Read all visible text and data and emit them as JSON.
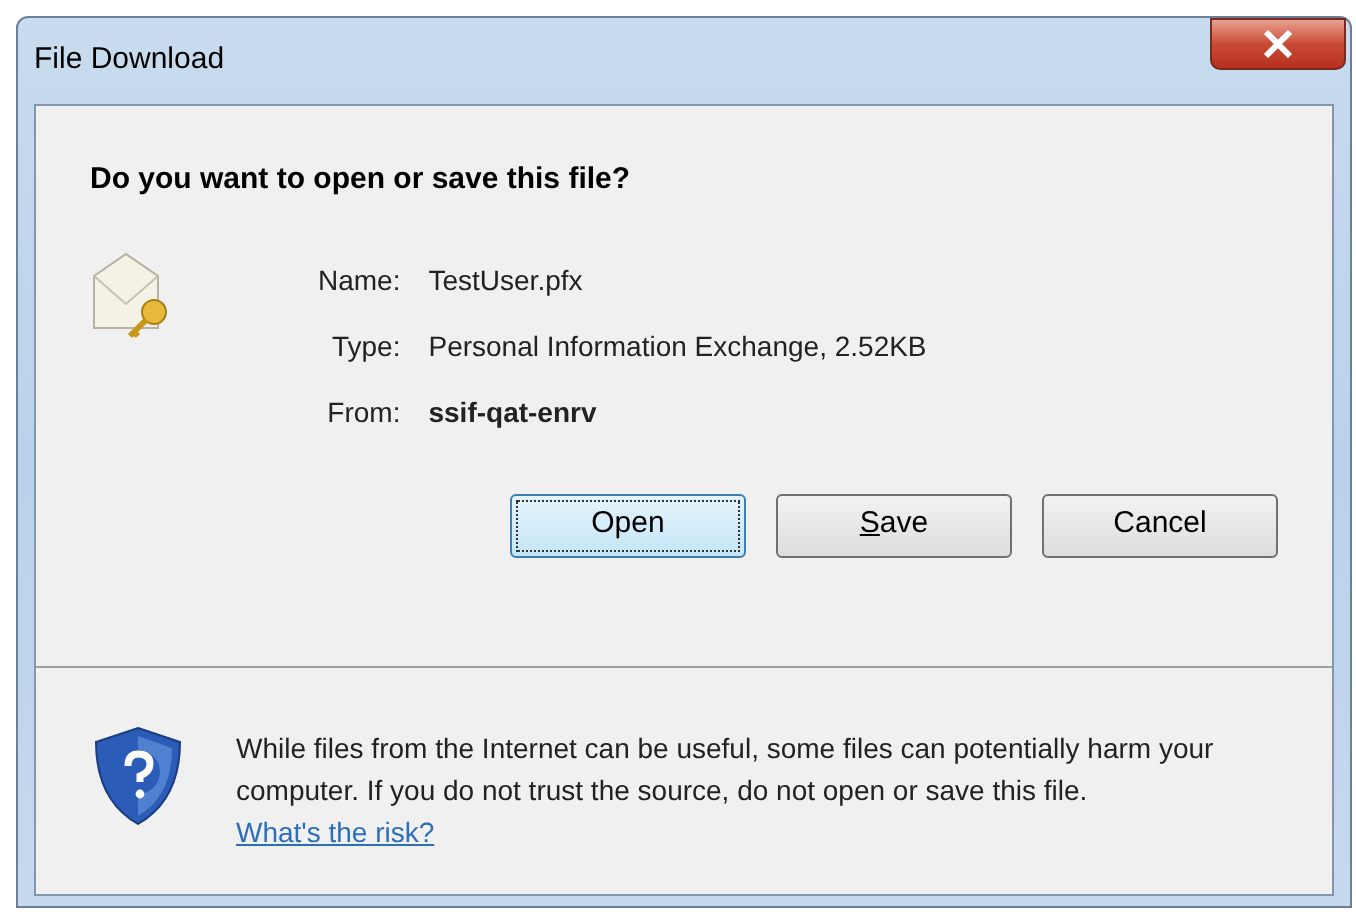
{
  "window": {
    "title": "File Download"
  },
  "heading": "Do you want to open or save this file?",
  "fields": [
    {
      "label": "Name:",
      "value": "TestUser.pfx",
      "bold": false
    },
    {
      "label": "Type:",
      "value": "Personal Information Exchange, 2.52KB",
      "bold": false
    },
    {
      "label": "From:",
      "value": "ssif-qat-enrv",
      "bold": true
    }
  ],
  "buttons": [
    {
      "label": "Open",
      "focused": true
    },
    {
      "access_key": "S",
      "label": "ave",
      "focused": false
    },
    {
      "label": "Cancel",
      "focused": false
    }
  ],
  "warning": {
    "text": "While files from the Internet can be useful, some files can potentially harm your computer. If you do not trust the source, do not open or save this file.",
    "link": "What's the risk?"
  }
}
